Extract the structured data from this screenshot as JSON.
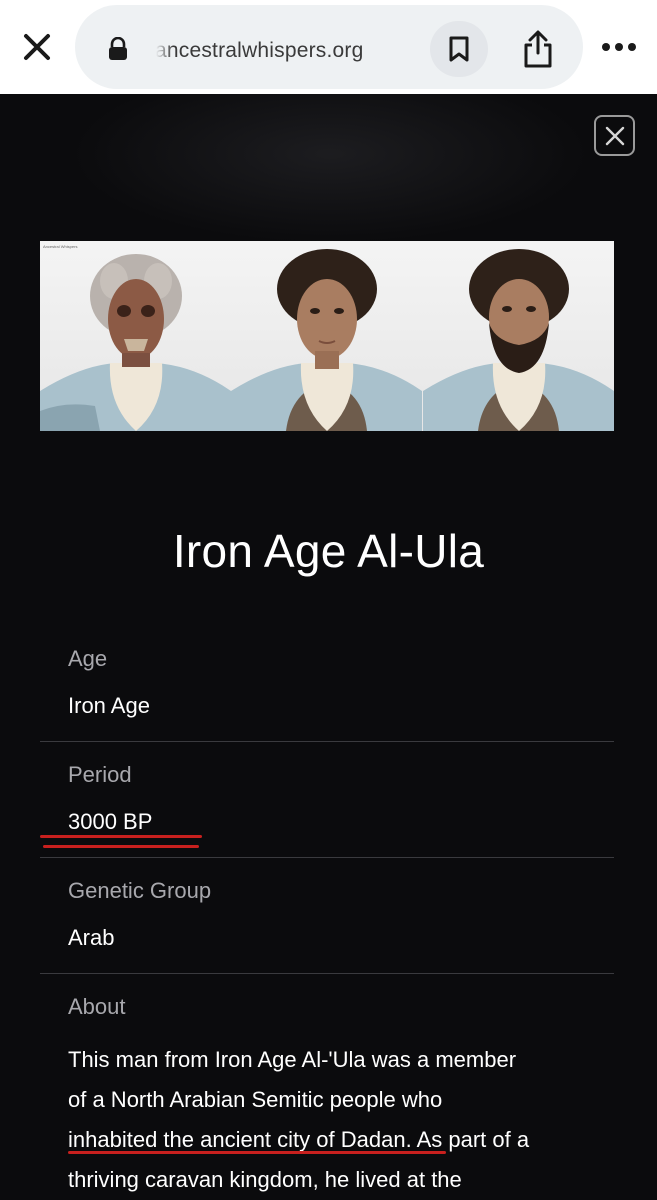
{
  "browser": {
    "url": "ancestralwhispers.org",
    "icons": {
      "close": "close-x-icon",
      "lock": "lock-icon",
      "bookmark": "bookmark-icon",
      "share": "share-icon",
      "more": "more-dots-icon"
    }
  },
  "modal": {
    "close_icon": "close-icon",
    "image_credit": "Ancestral Whispers",
    "title": "Iron Age Al-Ula",
    "fields": [
      {
        "label": "Age",
        "value": "Iron Age"
      },
      {
        "label": "Period",
        "value": "3000 BP"
      },
      {
        "label": "Genetic Group",
        "value": "Arab"
      }
    ],
    "about": {
      "label": "About",
      "lines": [
        "This man from Iron Age Al-'Ula was a member",
        "of a North Arabian Semitic people who",
        "inhabited the ancient city of Dadan. As part of a",
        "thriving caravan kingdom, he lived at the"
      ]
    }
  },
  "colors": {
    "background": "#0b0b0d",
    "label": "#a8a8ad",
    "text": "#ffffff",
    "divider": "#3a3a3e",
    "annotation_red": "#c8201e"
  }
}
